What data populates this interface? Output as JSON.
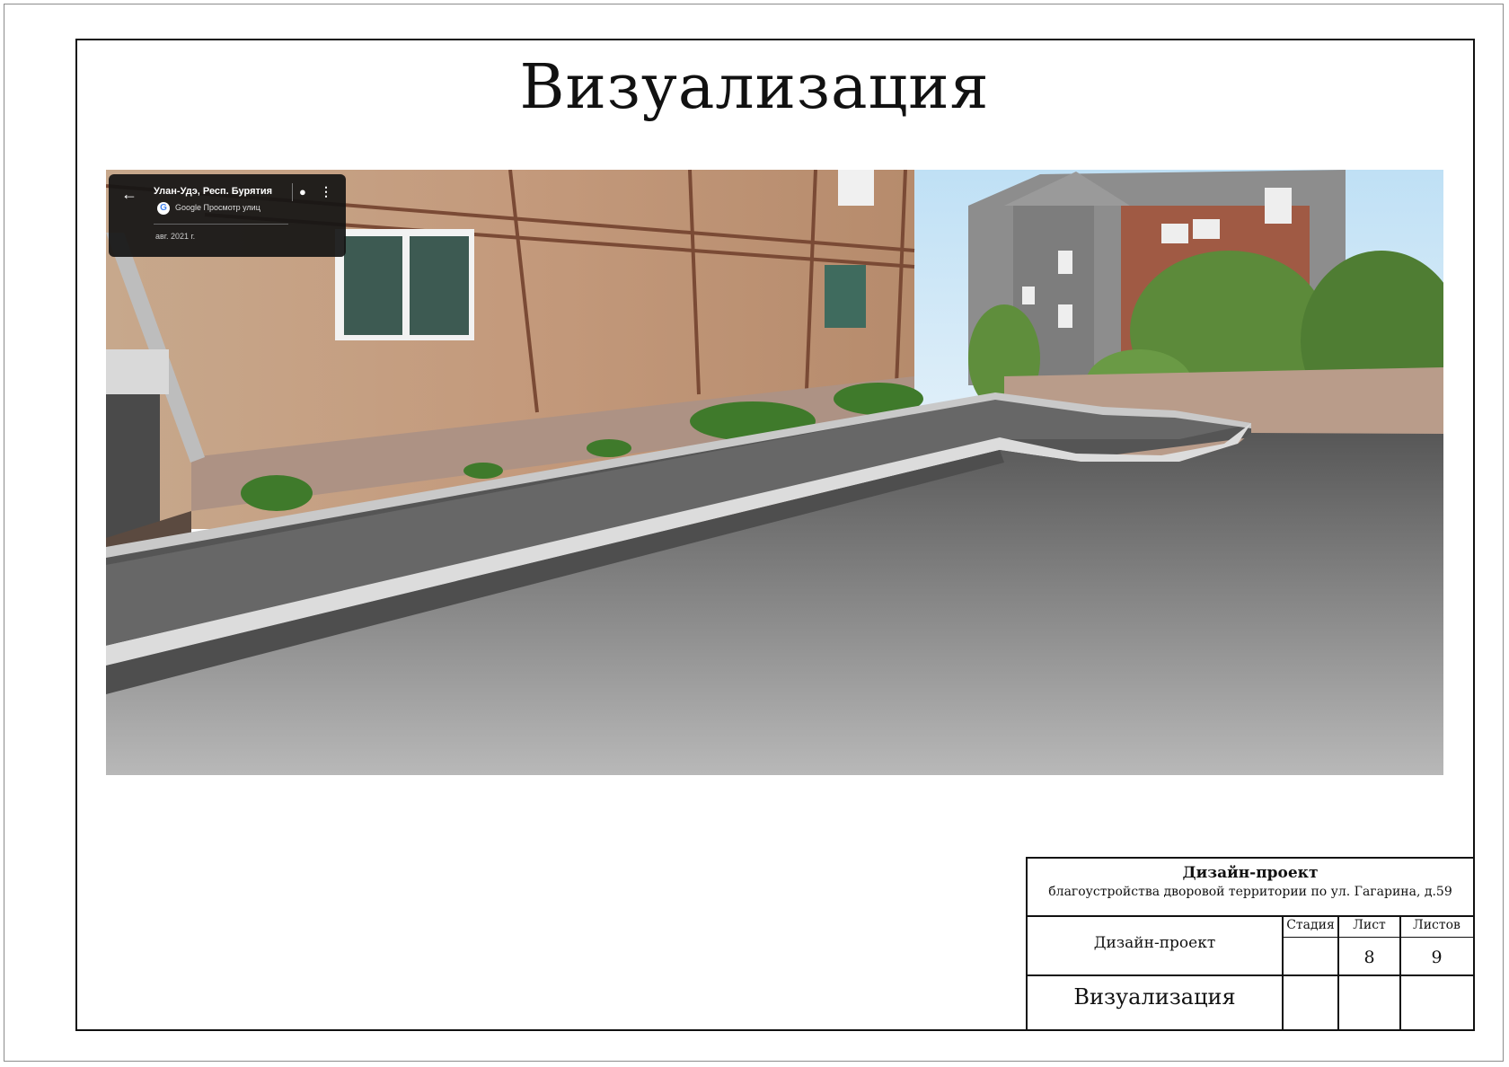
{
  "page": {
    "title": "Визуализация"
  },
  "streetview": {
    "location": "Улан-Удэ, Респ. Бурятия",
    "source": "Google Просмотр улиц",
    "date": "авг. 2021 г.",
    "back_icon": "arrow-left-icon",
    "pin_icon": "location-pin-icon",
    "menu_icon": "more-vert-icon"
  },
  "title_block": {
    "project_title": "Дизайн-проект",
    "project_subtitle": "благоустройства дворовой территории по ул.  Гагарина, д.59",
    "doc_type": "Дизайн-проект",
    "sheet_name": "Визуализация",
    "headers": {
      "stage": "Стадия",
      "sheet": "Лист",
      "sheets": "Листов"
    },
    "values": {
      "stage": "",
      "sheet": "8",
      "sheets": "9"
    }
  },
  "colors": {
    "border": "#111111",
    "asphalt": "#7a7a7a",
    "curb": "#d8d8d8"
  }
}
